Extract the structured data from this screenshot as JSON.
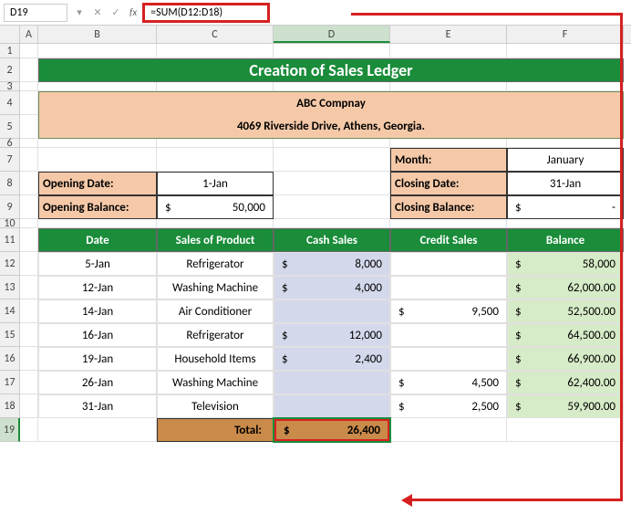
{
  "name_box": "D19",
  "formula": "=SUM(D12:D18)",
  "columns": [
    "A",
    "B",
    "C",
    "D",
    "E",
    "F"
  ],
  "row_numbers": [
    1,
    2,
    3,
    4,
    5,
    6,
    7,
    8,
    9,
    10,
    11,
    12,
    13,
    14,
    15,
    16,
    17,
    18,
    19
  ],
  "title": "Creation of Sales Ledger",
  "company": {
    "name": "ABC Compnay",
    "address": "4069 Riverside Drive, Athens, Georgia."
  },
  "top_left": {
    "opening_date_label": "Opening Date:",
    "opening_date_value": "1-Jan",
    "opening_balance_label": "Opening Balance:",
    "opening_balance_currency": "$",
    "opening_balance_value": "50,000"
  },
  "top_right": {
    "month_label": "Month:",
    "month_value": "January",
    "closing_date_label": "Closing Date:",
    "closing_date_value": "31-Jan",
    "closing_balance_label": "Closing Balance:",
    "closing_balance_currency": "$",
    "closing_balance_value": "-"
  },
  "headers": {
    "date": "Date",
    "product": "Sales of Product",
    "cash": "Cash Sales",
    "credit": "Credit Sales",
    "balance": "Balance"
  },
  "rows": [
    {
      "date": "5-Jan",
      "product": "Refrigerator",
      "cash_c": "$",
      "cash": "8,000",
      "credit_c": "",
      "credit": "",
      "bal_c": "$",
      "balance": "58,000"
    },
    {
      "date": "12-Jan",
      "product": "Washing Machine",
      "cash_c": "$",
      "cash": "4,000",
      "credit_c": "",
      "credit": "",
      "bal_c": "$",
      "balance": "62,000.00"
    },
    {
      "date": "14-Jan",
      "product": "Air Conditioner",
      "cash_c": "",
      "cash": "",
      "credit_c": "$",
      "credit": "9,500",
      "bal_c": "$",
      "balance": "52,500.00"
    },
    {
      "date": "16-Jan",
      "product": "Refrigerator",
      "cash_c": "$",
      "cash": "12,000",
      "credit_c": "",
      "credit": "",
      "bal_c": "$",
      "balance": "64,500.00"
    },
    {
      "date": "19-Jan",
      "product": "Household Items",
      "cash_c": "$",
      "cash": "2,400",
      "credit_c": "",
      "credit": "",
      "bal_c": "$",
      "balance": "66,900.00"
    },
    {
      "date": "26-Jan",
      "product": "Washing Machine",
      "cash_c": "",
      "cash": "",
      "credit_c": "$",
      "credit": "4,500",
      "bal_c": "$",
      "balance": "62,400.00"
    },
    {
      "date": "31-Jan",
      "product": "Television",
      "cash_c": "",
      "cash": "",
      "credit_c": "$",
      "credit": "2,500",
      "bal_c": "$",
      "balance": "59,900.00"
    }
  ],
  "total": {
    "label": "Total:",
    "currency": "$",
    "value": "26,400"
  }
}
